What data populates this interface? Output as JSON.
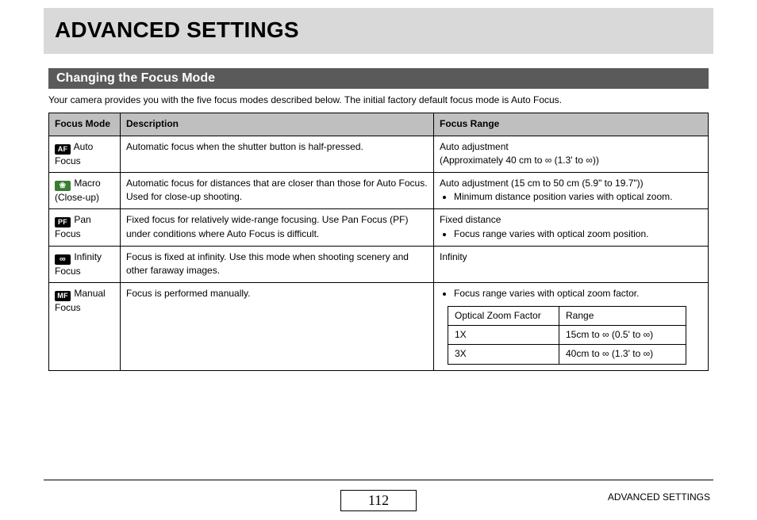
{
  "title": "ADVANCED SETTINGS",
  "section_title": "Changing the Focus Mode",
  "intro": "Your camera provides you with the five focus modes described below. The initial factory default focus mode is Auto Focus.",
  "headers": {
    "mode": "Focus Mode",
    "desc": "Description",
    "range": "Focus Range"
  },
  "rows": {
    "auto": {
      "icon_text": "AF",
      "mode_label_a": "Auto",
      "mode_label_b": "Focus",
      "desc": "Automatic focus when the shutter button is half-pressed.",
      "range_line1": "Auto adjustment",
      "range_line2_a": "(Approximately 40 cm to ",
      "range_line2_b": " (1.3' to ",
      "range_line2_c": "))"
    },
    "macro": {
      "icon_text": "❀",
      "mode_label_a": "Macro",
      "mode_label_b": "(Close-up)",
      "desc": "Automatic focus for distances that are closer than those for Auto Focus. Used for close-up shooting.",
      "range_line1": "Auto adjustment (15 cm to 50 cm (5.9\" to 19.7\"))",
      "bullet": "Minimum distance position varies with optical zoom."
    },
    "pan": {
      "icon_text": "PF",
      "mode_label_a": "Pan",
      "mode_label_b": "Focus",
      "desc": "Fixed focus for relatively wide-range focusing. Use Pan Focus (PF) under conditions where Auto Focus is difficult.",
      "range_line1": "Fixed distance",
      "bullet": "Focus range varies with optical zoom position."
    },
    "infinity": {
      "icon_text": "∞",
      "mode_label_a": "Infinity",
      "mode_label_b": "Focus",
      "desc": "Focus is fixed at infinity. Use this mode when shooting scenery and other faraway images.",
      "range_line1": "Infinity"
    },
    "manual": {
      "icon_text": "MF",
      "mode_label_a": "Manual",
      "mode_label_b": "Focus",
      "desc": "Focus is performed manually.",
      "bullet": "Focus range varies with optical zoom factor.",
      "inner_headers": {
        "factor": "Optical Zoom Factor",
        "range": "Range"
      },
      "inner": {
        "r1": {
          "factor": "1X",
          "range_a": "15cm to ",
          "range_b": " (0.5' to ",
          "range_c": ")"
        },
        "r2": {
          "factor": "3X",
          "range_a": "40cm to ",
          "range_b": " (1.3' to ",
          "range_c": ")"
        }
      }
    }
  },
  "infinity_symbol": "∞",
  "footer": {
    "page_no": "112",
    "label": "ADVANCED SETTINGS"
  }
}
